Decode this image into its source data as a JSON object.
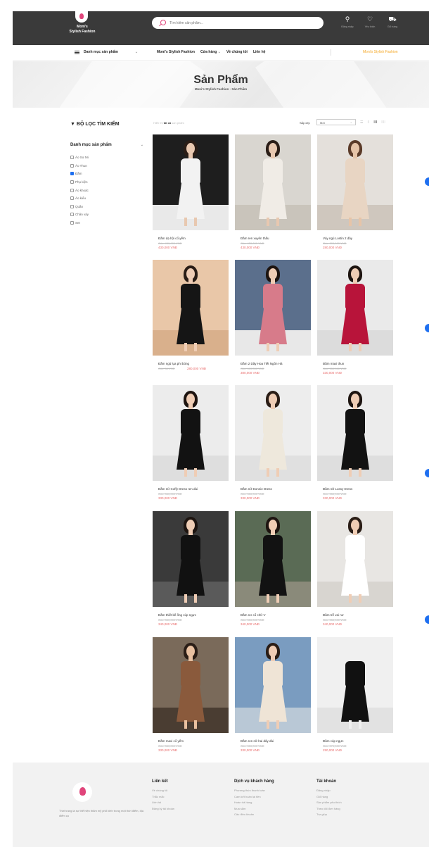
{
  "header": {
    "brand_line1": "Moni's",
    "brand_line2": "Stylish Fashion",
    "search_placeholder": "Tìm kiếm sản phẩm...",
    "icons": [
      {
        "icon": "user-icon",
        "label": "Đăng nhập"
      },
      {
        "icon": "heart-icon",
        "label": "Yêu thích"
      },
      {
        "icon": "cart-icon",
        "label": "Giỏ hàng"
      }
    ]
  },
  "nav": {
    "category_label": "Danh mục sản phẩm",
    "links": [
      "Moni's Stylish Fashion",
      "Cửa hàng",
      "Về chúng tôi",
      "Liên hệ"
    ],
    "store_dropdown": "⌄",
    "brand_right": "Moni's Stylish Fashion"
  },
  "hero": {
    "title": "Sản Phẩm",
    "breadcrumb_home": "Moni's Stylish Fashion",
    "breadcrumb_sep": "›",
    "breadcrumb_current": "Sản Phẩm"
  },
  "sidebar": {
    "title": "BỘ LỌC TÌM KIẾM",
    "category_title": "Danh mục sản phẩm",
    "filters": [
      {
        "label": "Áo Sơ Mi",
        "checked": false
      },
      {
        "label": "Áo Thun",
        "checked": false
      },
      {
        "label": "Đầm",
        "checked": true
      },
      {
        "label": "Phụ kiện",
        "checked": false
      },
      {
        "label": "Áo khoác",
        "checked": false
      },
      {
        "label": "Áo kiểu",
        "checked": false
      },
      {
        "label": "Quần",
        "checked": false
      },
      {
        "label": "Chân váy",
        "checked": false
      },
      {
        "label": "Set",
        "checked": false
      }
    ]
  },
  "toolbar": {
    "result_prefix": "Hiển thị",
    "result_bold": "tất cả",
    "result_suffix": "sản phẩm",
    "sort_label": "Sắp xếp",
    "sort_value": "Mới",
    "sort_arrow": "⌄"
  },
  "products": [
    {
      "name": "Đầm dạ hội cổ yếm",
      "old": "Gốc: 450,000 VNĐ",
      "price": "430,000 VNĐ"
    },
    {
      "name": "Đầm ren xuyên thấu",
      "old": "Gốc: 450,000 VNĐ",
      "price": "430,000 VNĐ"
    },
    {
      "name": "Váy ngủ Lostin 2 dây",
      "old": "Gốc: 300,000 VNĐ",
      "price": "280,000 VNĐ"
    },
    {
      "name": "Đầm ngủ lụa phi bóng",
      "old": "Gốc: 30 VNĐ",
      "price": "280,000 VNĐ"
    },
    {
      "name": "Đầm 2 Dây Hoa Tiết Ngôn Hà",
      "old": "Gốc: 400,000 VNĐ",
      "price": "380,000 VNĐ"
    },
    {
      "name": "Đầm maxi thun",
      "old": "Gốc: 350,000 VNĐ",
      "price": "330,000 VNĐ"
    },
    {
      "name": "Đầm nữ Coffy Dress ren dài",
      "old": "Gốc: 350,000 VNĐ",
      "price": "330,000 VNĐ"
    },
    {
      "name": "Đầm nữ Donnie Dress",
      "old": "Gốc: 350,000 VNĐ",
      "price": "330,000 VNĐ"
    },
    {
      "name": "Đầm nữ Lussy Dress",
      "old": "Gốc: 350,000 VNĐ",
      "price": "330,000 VNĐ"
    },
    {
      "name": "Đầm thiết kế ống cúp ngực",
      "old": "Gốc: 350,000 VNĐ",
      "price": "340,000 VNĐ"
    },
    {
      "name": "Đầm nơ cổ chữ V",
      "old": "Gốc: 350,000 VNĐ",
      "price": "340,000 VNĐ"
    },
    {
      "name": "Đầm trễ vai nơ",
      "old": "Gốc: 350,000 VNĐ",
      "price": "340,000 VNĐ"
    },
    {
      "name": "Đầm maxi cổ yếm",
      "old": "Gốc: 350,000 VNĐ",
      "price": "330,000 VNĐ"
    },
    {
      "name": "Đầm ren nữ hai dây dài",
      "old": "Gốc: 350,000 VNĐ",
      "price": "330,000 VNĐ"
    },
    {
      "name": "Đầm cúp ngực",
      "old": "Gốc: 270,000 VNĐ",
      "price": "250,000 VNĐ"
    }
  ],
  "footer": {
    "description": "Thời trang là sự thể hiện thẩm mỹ phổ biến trong một thời điểm, địa điểm cụ",
    "columns": [
      {
        "title": "Liên kết",
        "items": [
          "Về chúng tôi",
          "Thắc mắc",
          "Liên hệ",
          "Đăng ký tài khoản"
        ]
      },
      {
        "title": "Dịch vụ khách hàng",
        "items": [
          "Phương thức thanh toán",
          "Cam kết hoàn lại tiền",
          "Hoàn trả hàng",
          "Mua sắm",
          "Câu điều khoản"
        ]
      },
      {
        "title": "Tài khoản",
        "items": [
          "Đăng nhập",
          "Giỏ hàng",
          "Sản phẩm yêu thích",
          "Theo dõi đơn hàng",
          "Trợ giúp"
        ]
      }
    ]
  }
}
